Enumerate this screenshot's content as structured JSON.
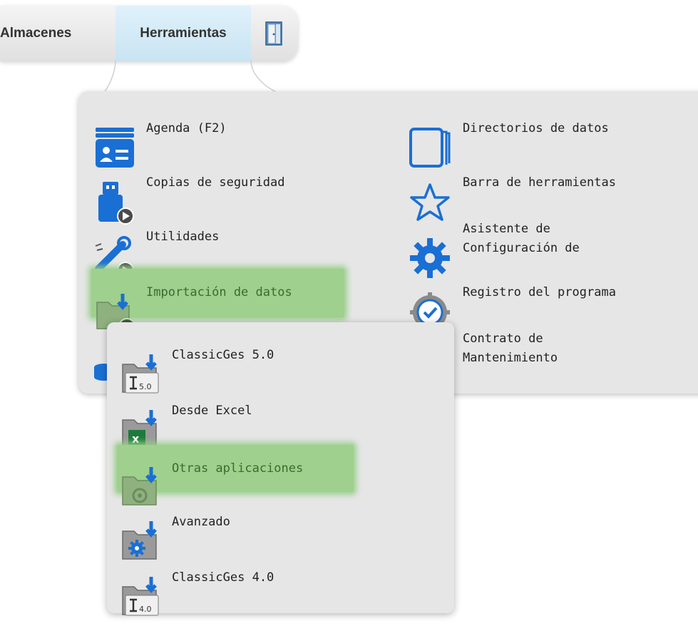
{
  "menubar": {
    "items": [
      {
        "label": "Almacenes"
      },
      {
        "label": "Herramientas",
        "active": true
      }
    ],
    "door_icon": "exit-door-icon"
  },
  "tools_menu": {
    "left_column": [
      {
        "label": "Agenda (F2)",
        "icon": "contacts-book-icon"
      },
      {
        "label": "Copias de seguridad",
        "icon": "usb-backup-icon"
      },
      {
        "label": "Utilidades",
        "icon": "tools-wrench-icon"
      },
      {
        "label": "Importación de datos",
        "icon": "folder-import-icon",
        "highlighted": true
      },
      {
        "label": "",
        "icon": "database-icon"
      }
    ],
    "right_column": [
      {
        "label": "Directorios de datos",
        "icon": "directories-icon"
      },
      {
        "label": "Barra de herramientas",
        "icon": "star-icon"
      },
      {
        "label": "Asistente de\nConfiguración de",
        "icon": "gear-icon"
      },
      {
        "label": "Registro del programa",
        "icon": "registration-check-icon"
      },
      {
        "label": "Contrato de\nMantenimiento",
        "icon": "contract-icon"
      }
    ]
  },
  "import_submenu": {
    "items": [
      {
        "label": "ClassicGes 5.0",
        "icon": "classicges-5-icon"
      },
      {
        "label": "Desde Excel",
        "icon": "excel-import-icon"
      },
      {
        "label": "Otras aplicaciones",
        "icon": "other-apps-import-icon",
        "highlighted": true
      },
      {
        "label": "Avanzado",
        "icon": "advanced-import-icon"
      },
      {
        "label": "ClassicGes 4.0",
        "icon": "classicges-4-icon"
      }
    ]
  },
  "colors": {
    "panel_bg": "#e6e6e6",
    "highlight": "#9fd08d",
    "accent_blue": "#1a6fd4",
    "menubar_active": "#cfe8f5"
  }
}
